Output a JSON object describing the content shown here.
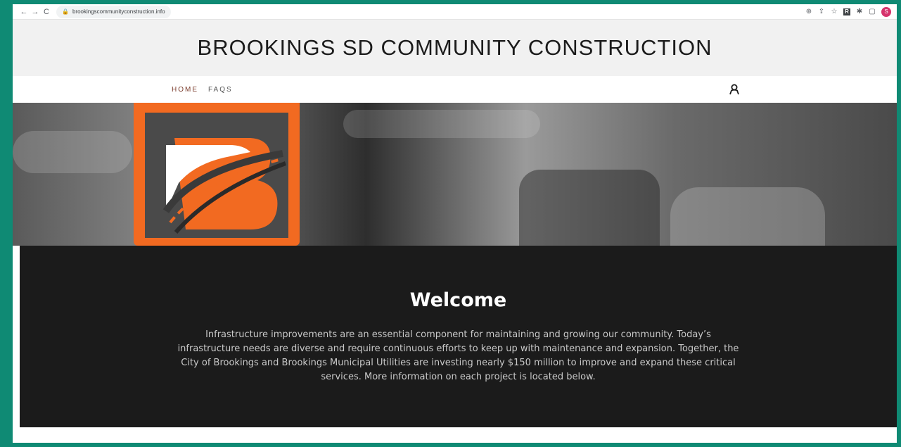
{
  "browser": {
    "url": "brookingscommunityconstruction.info",
    "profile_initial": "S"
  },
  "site": {
    "title": "BROOKINGS SD COMMUNITY CONSTRUCTION"
  },
  "nav": {
    "items": [
      {
        "label": "HOME",
        "active": true
      },
      {
        "label": "FAQS",
        "active": false
      }
    ]
  },
  "welcome": {
    "heading": "Welcome",
    "body": "Infrastructure improvements are an essential component for maintaining and growing our community. Today’s infrastructure needs are diverse and require continuous efforts to keep up with maintenance and expansion. Together, the City of Brookings and Brookings Municipal Utilities are investing nearly $150 million to improve and expand these critical services. More information on each project is located below."
  },
  "colors": {
    "frame": "#0f8a74",
    "brand_orange": "#f26a21",
    "welcome_bg": "#1b1b1b",
    "nav_active": "#7a3a2a"
  },
  "icons": {
    "back": "arrow-left-icon",
    "forward": "arrow-right-icon",
    "reload": "reload-icon",
    "lock": "lock-icon",
    "account": "person-icon"
  }
}
